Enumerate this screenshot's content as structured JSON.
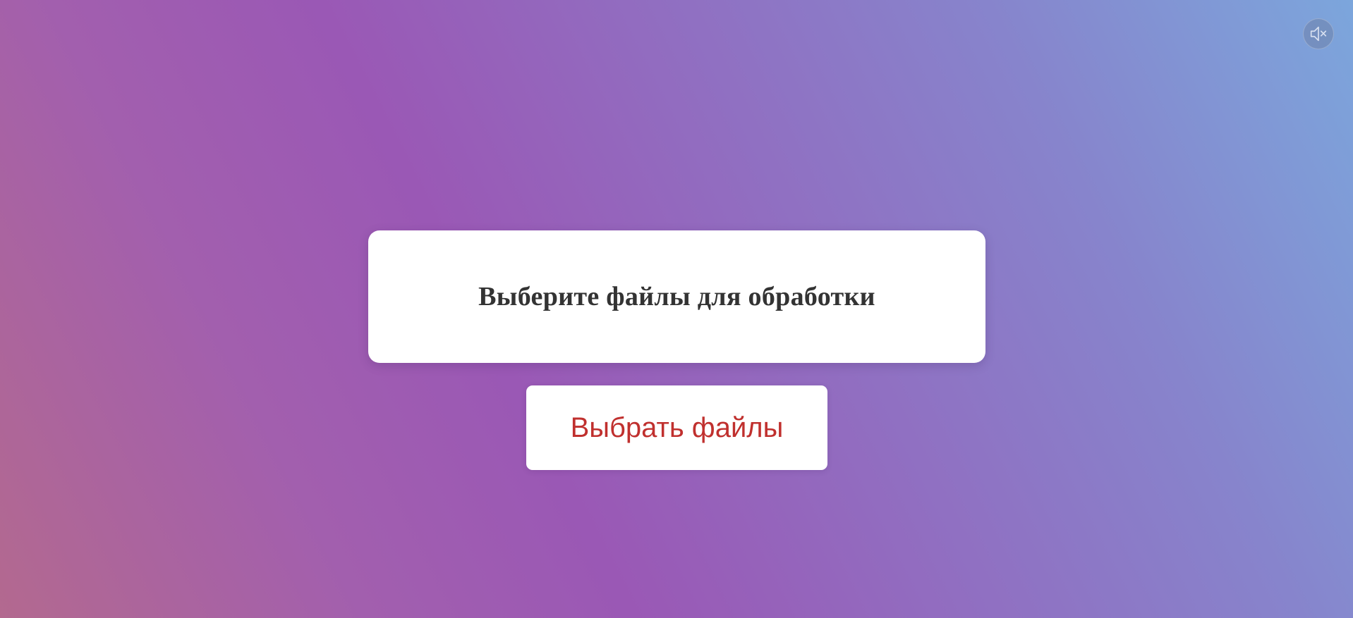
{
  "audio": {
    "icon": "speaker-muted-icon",
    "state": "muted"
  },
  "upload": {
    "title": "Выберите файлы для обработки",
    "button_label": "Выбрать файлы"
  },
  "colors": {
    "background_start": "#b3698f",
    "background_mid": "#9a58b5",
    "background_end": "#7ca6dc",
    "card": "#ffffff",
    "title_text": "#333333",
    "button_text": "#c0302e"
  }
}
